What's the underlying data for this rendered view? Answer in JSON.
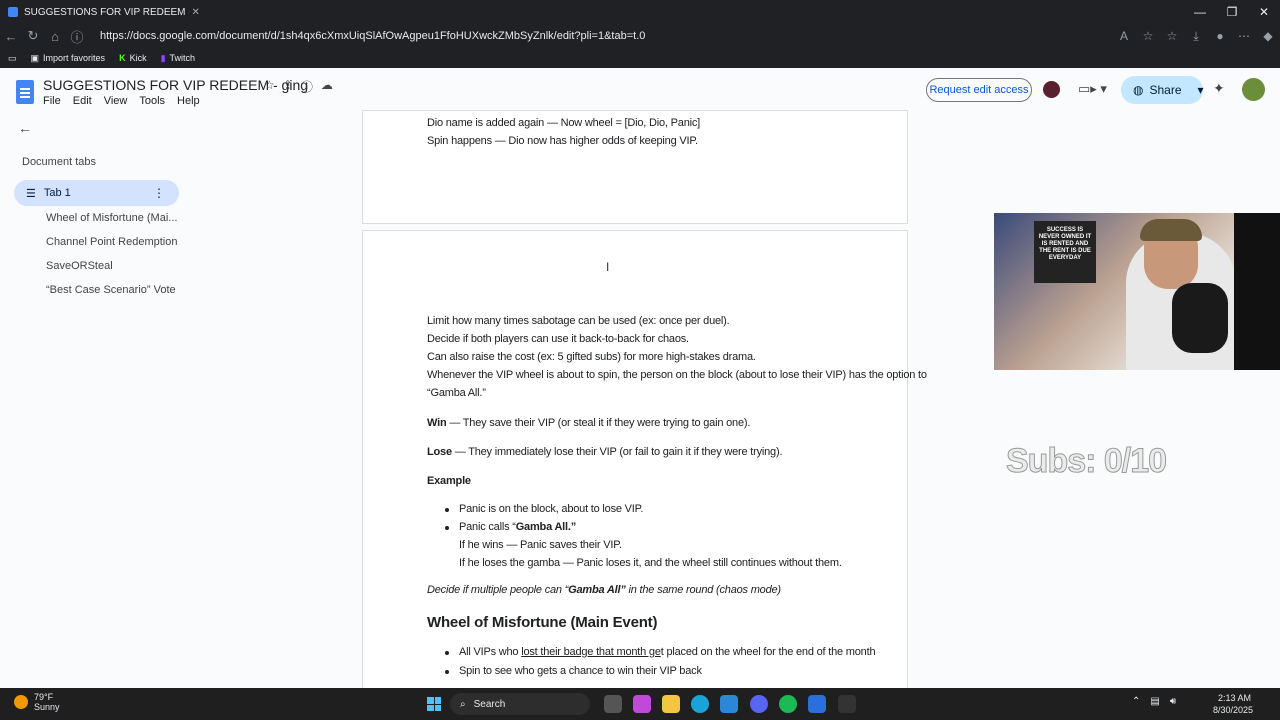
{
  "browser": {
    "tab_title": "SUGGESTIONS FOR VIP REDEEM",
    "url": "https://docs.google.com/document/d/1sh4qx6cXmxUiqSlAfOwAgpeu1FfoHUXwckZMbSyZnlk/edit?pli=1&tab=t.0",
    "bookmarks": [
      "Import favorites",
      "Kick",
      "Twitch"
    ]
  },
  "doc": {
    "title": "SUGGESTIONS FOR VIP REDEEM - ging",
    "menus": [
      "File",
      "Edit",
      "View",
      "Tools",
      "Help"
    ],
    "request_edit": "Request edit access",
    "share": "Share"
  },
  "sidebar": {
    "title": "Document tabs",
    "active_tab": "Tab 1",
    "outline": [
      "Wheel of Misfortune (Mai...",
      "Channel Point Redemption",
      "SaveORSteal",
      "“Best Case Scenario” Vote"
    ]
  },
  "page1": {
    "lines": [
      "Dio name is added again — Now wheel = [Dio, Dio, Panic]",
      "Spin happens — Dio now has higher odds of keeping VIP."
    ]
  },
  "page2": {
    "p1": "Limit how many times sabotage can be used (ex: once per duel).",
    "p2": "Decide if both players can use it back-to-back for chaos.",
    "p3": "Can also raise the cost (ex: 5 gifted subs) for more high-stakes drama.",
    "p4a": "Whenever the VIP wheel is about to spin, the person on the block (about to lose their VIP) has the option to",
    "p4b": "“Gamba All.”",
    "win_label": "Win",
    "win_text": " — They save their VIP (or steal it if they were trying to gain one).",
    "lose_label": "Lose",
    "lose_text": " — They immediately lose their VIP (or fail to gain it if they were trying).",
    "example": "Example",
    "b1": "Panic is on the block, about to lose VIP.",
    "b2a": "Panic calls “",
    "b2b": "Gamba All.”",
    "b2c": "If he wins — Panic saves their VIP.",
    "b2d": "If he loses the gamba — Panic loses it, and the wheel still continues without them.",
    "italic_a": "Decide if multiple people can “",
    "italic_b": "Gamba All”",
    "italic_c": " in the same round (chaos mode)",
    "heading": "Wheel of Misfortune (Main Event)",
    "b3a": "All VIPs who ",
    "b3b": "lost their badge that month ge",
    "b3c": "t placed on the wheel for the end of the month",
    "b4": "Spin to see who gets a chance to win their VIP back"
  },
  "overlay": {
    "subs": "Subs: 0/10",
    "poster": "SUCCESS IS NEVER OWNED IT IS RENTED AND THE RENT IS DUE EVERYDAY"
  },
  "taskbar": {
    "temp": "79°F",
    "weather": "Sunny",
    "search": "Search",
    "time": "2:13 AM",
    "date": "8/30/2025"
  }
}
